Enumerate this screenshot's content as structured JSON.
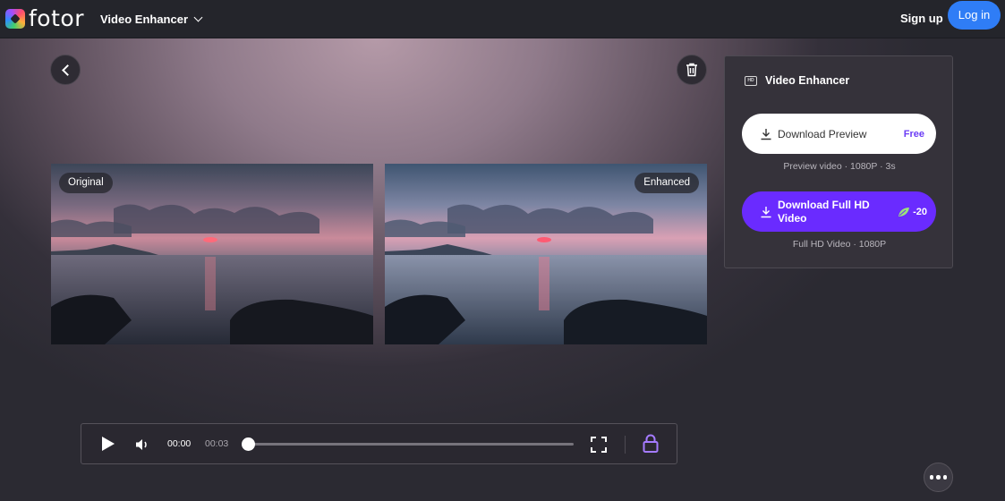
{
  "header": {
    "logo_text": "fotor",
    "tool_menu_label": "Video Enhancer",
    "signup_label": "Sign up",
    "login_label": "Log in"
  },
  "comparison": {
    "original_label": "Original",
    "enhanced_label": "Enhanced"
  },
  "panel": {
    "title": "Video Enhancer",
    "preview_button": {
      "label": "Download Preview",
      "badge": "Free",
      "caption": "Preview video · 1080P · 3s"
    },
    "full_button": {
      "label": "Download Full HD Video",
      "credits": "-20",
      "caption": "Full HD Video · 1080P"
    }
  },
  "player": {
    "current_time": "00:00",
    "duration": "00:03",
    "progress": 0
  },
  "colors": {
    "brand_accent": "#6a2bff",
    "login_blue": "#2f7df6",
    "lock_purple": "#a57bff"
  },
  "icons": [
    "chevron-down-icon",
    "back-arrow-icon",
    "trash-icon",
    "hd-icon",
    "download-icon",
    "leaf-credit-icon",
    "play-icon",
    "volume-icon",
    "fullscreen-icon",
    "lock-icon",
    "more-icon"
  ]
}
